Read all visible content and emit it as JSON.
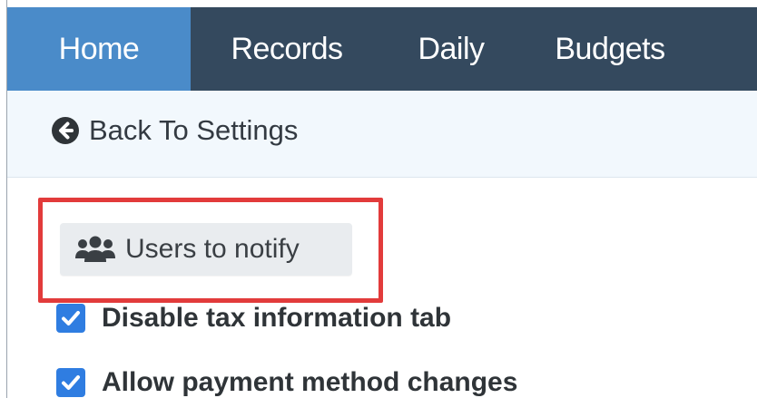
{
  "nav": {
    "tabs": [
      {
        "label": "Home",
        "active": true
      },
      {
        "label": "Records",
        "active": false
      },
      {
        "label": "Daily",
        "active": false
      },
      {
        "label": "Budgets",
        "active": false
      }
    ]
  },
  "subnav": {
    "back_label": "Back To Settings",
    "back_icon": "arrow-circle-left-icon"
  },
  "main": {
    "notify_button": {
      "label": "Users to notify",
      "icon": "users-icon"
    },
    "checkboxes": [
      {
        "label": "Disable tax information tab",
        "checked": true
      },
      {
        "label": "Allow payment method changes",
        "checked": true
      }
    ]
  },
  "colors": {
    "navbar_bg": "#34495e",
    "active_tab_bg": "#4a8bc9",
    "subbar_bg": "#f2f8fd",
    "checkbox_blue": "#2f7de1",
    "highlight_red": "#e23b3b",
    "button_bg": "#e9ecef"
  }
}
